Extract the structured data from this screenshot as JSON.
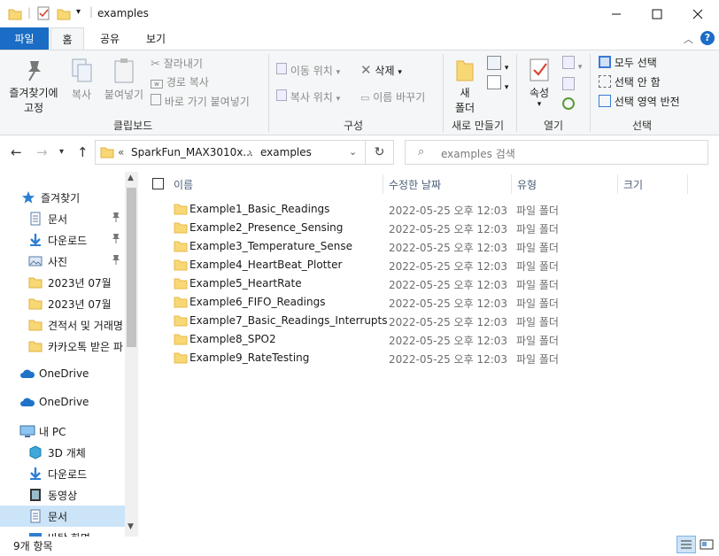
{
  "window": {
    "title": "examples"
  },
  "ribbon_tabs": {
    "file": "파일",
    "home": "홈",
    "share": "공유",
    "view": "보기"
  },
  "clipboard": {
    "pin_line1": "즐겨찾기에",
    "pin_line2": "고정",
    "copy": "복사",
    "paste": "붙여넣기",
    "cut": "잘라내기",
    "copy_path": "경로 복사",
    "paste_shortcut": "바로 가기 붙여넣기",
    "group": "클립보드"
  },
  "organize": {
    "move_to": "이동 위치",
    "copy_to": "복사 위치",
    "delete": "삭제",
    "rename": "이름 바꾸기",
    "group": "구성"
  },
  "new": {
    "folder_line1": "새",
    "folder_line2": "폴더",
    "group": "새로 만들기"
  },
  "open": {
    "properties": "속성",
    "group": "열기"
  },
  "select": {
    "all": "모두 선택",
    "none": "선택 안 함",
    "invert": "선택 영역 반전",
    "group": "선택"
  },
  "address": {
    "prefix": "«",
    "crumb1": "SparkFun_MAX3010x...",
    "crumb2": "examples"
  },
  "search": {
    "placeholder": "examples 검색"
  },
  "columns": {
    "name": "이름",
    "modified": "수정한 날짜",
    "type": "유형",
    "size": "크기"
  },
  "nav": [
    {
      "label": "즐겨찾기",
      "icon": "star-icon"
    },
    {
      "label": "문서",
      "icon": "document-icon",
      "pinned": true
    },
    {
      "label": "다운로드",
      "icon": "download-icon",
      "pinned": true
    },
    {
      "label": "사진",
      "icon": "picture-icon",
      "pinned": true
    },
    {
      "label": "2023년 07월",
      "icon": "folder-icon"
    },
    {
      "label": "2023년 07월",
      "icon": "folder-icon"
    },
    {
      "label": "견적서 및 거래명",
      "icon": "folder-icon"
    },
    {
      "label": "카카오톡 받은 파",
      "icon": "folder-icon"
    },
    {
      "label": "OneDrive",
      "icon": "cloud-icon"
    },
    {
      "label": "OneDrive",
      "icon": "cloud-icon"
    },
    {
      "label": "내 PC",
      "icon": "pc-icon"
    },
    {
      "label": "3D 개체",
      "icon": "cube-icon"
    },
    {
      "label": "다운로드",
      "icon": "download-icon"
    },
    {
      "label": "동영상",
      "icon": "video-icon"
    },
    {
      "label": "문서",
      "icon": "document-icon"
    },
    {
      "label": "바탕 화면",
      "icon": "desktop-icon"
    }
  ],
  "files": [
    {
      "name": "Example1_Basic_Readings",
      "modified": "2022-05-25 오후 12:03",
      "type": "파일 폴더"
    },
    {
      "name": "Example2_Presence_Sensing",
      "modified": "2022-05-25 오후 12:03",
      "type": "파일 폴더"
    },
    {
      "name": "Example3_Temperature_Sense",
      "modified": "2022-05-25 오후 12:03",
      "type": "파일 폴더"
    },
    {
      "name": "Example4_HeartBeat_Plotter",
      "modified": "2022-05-25 오후 12:03",
      "type": "파일 폴더"
    },
    {
      "name": "Example5_HeartRate",
      "modified": "2022-05-25 오후 12:03",
      "type": "파일 폴더"
    },
    {
      "name": "Example6_FIFO_Readings",
      "modified": "2022-05-25 오후 12:03",
      "type": "파일 폴더"
    },
    {
      "name": "Example7_Basic_Readings_Interrupts",
      "modified": "2022-05-25 오후 12:03",
      "type": "파일 폴더"
    },
    {
      "name": "Example8_SPO2",
      "modified": "2022-05-25 오후 12:03",
      "type": "파일 폴더"
    },
    {
      "name": "Example9_RateTesting",
      "modified": "2022-05-25 오후 12:03",
      "type": "파일 폴더"
    }
  ],
  "status": {
    "count": "9개 항목"
  },
  "colors": {
    "accent": "#1a6cc4",
    "folder": "#f8d775",
    "folder_dark": "#e8b94a",
    "selection": "#cce4f7"
  }
}
